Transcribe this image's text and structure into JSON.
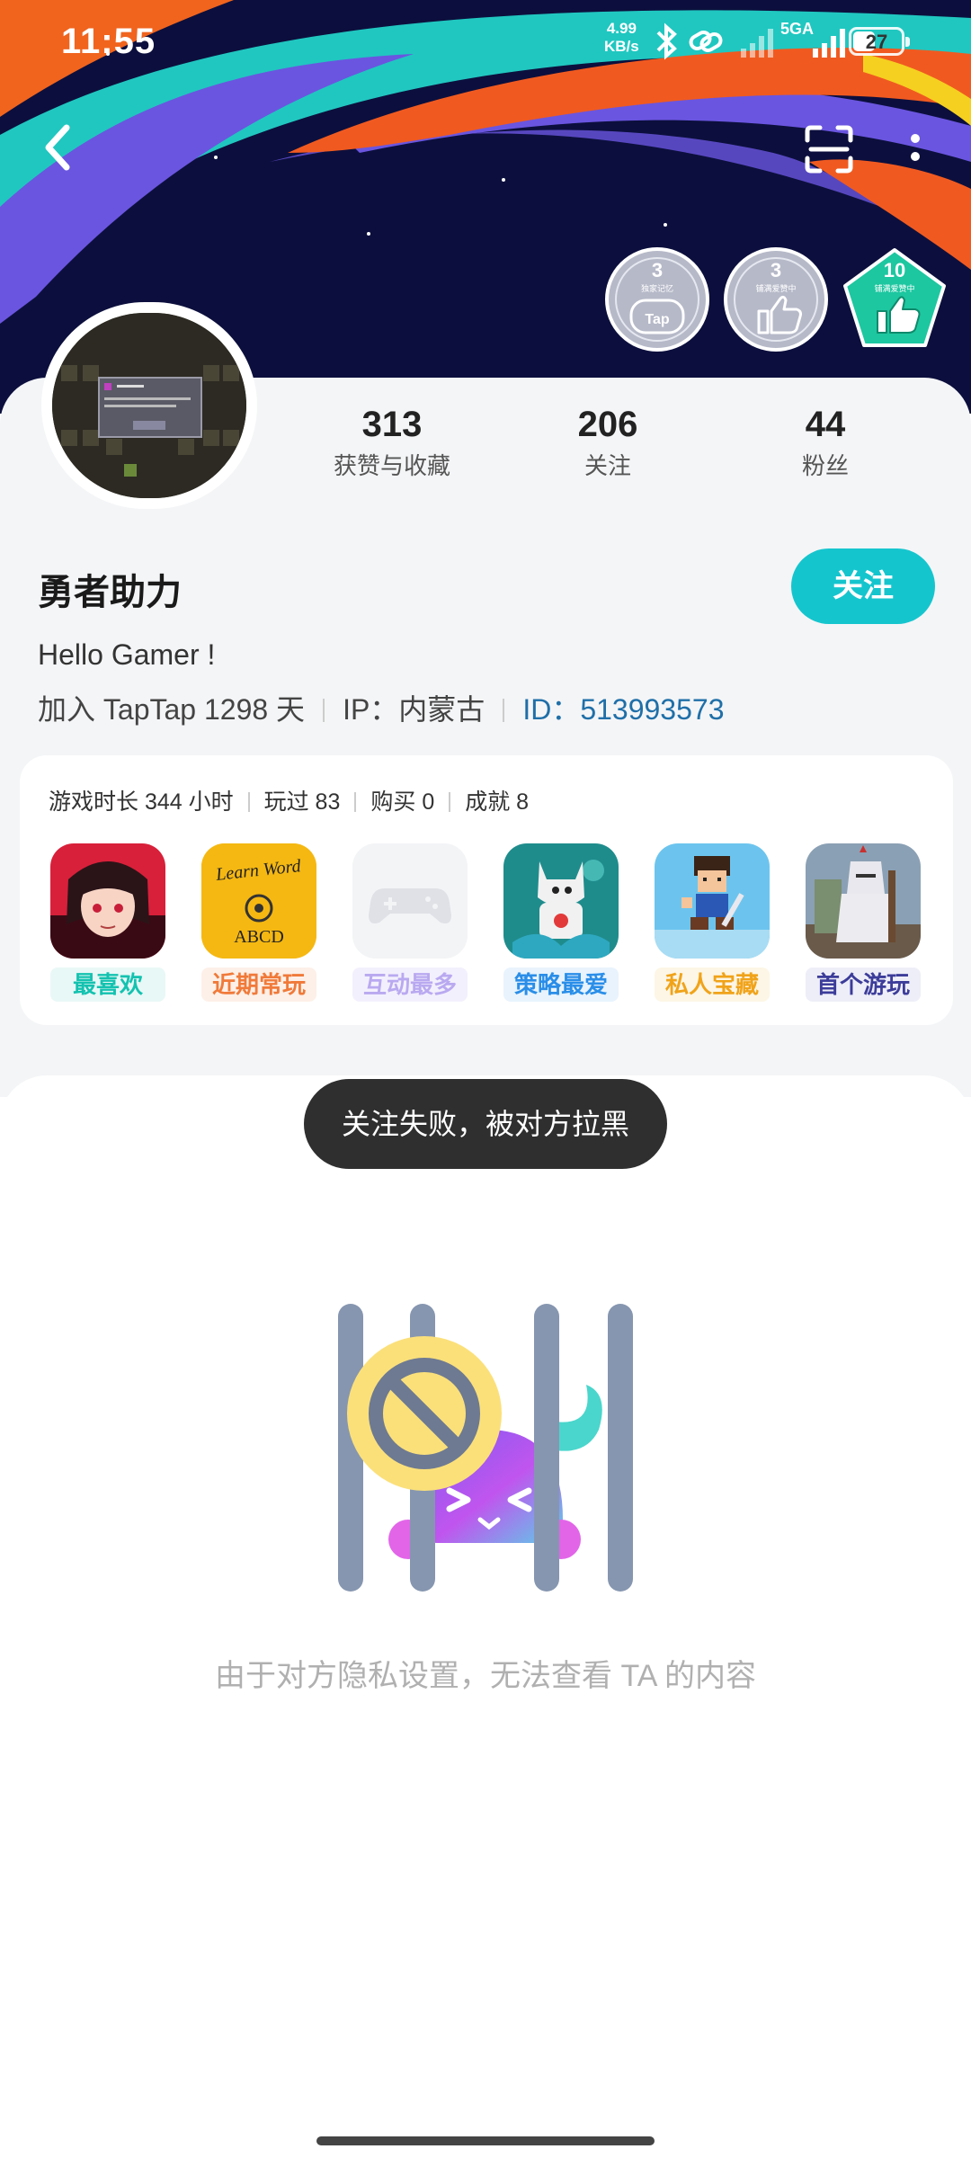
{
  "status_bar": {
    "time": "11:55",
    "net_speed_value": "4.99",
    "net_speed_unit": "KB/s",
    "network": "5GA",
    "battery": "27"
  },
  "header": {
    "badges": [
      {
        "count": "3",
        "title": "独家记忆",
        "glyph": "Tap",
        "color": "#b6b9c8"
      },
      {
        "count": "3",
        "title": "铺满爱赞中",
        "color": "#b6b9c8"
      },
      {
        "count": "10",
        "title": "铺满爱赞中",
        "color": "#1dc7a0"
      }
    ]
  },
  "profile": {
    "name": "勇者助力",
    "follow_label": "关注",
    "bio": "Hello Gamer !",
    "joined": "加入 TapTap 1298 天",
    "ip": "IP：内蒙古",
    "id": "ID：513993573",
    "stats": [
      {
        "value": "313",
        "label": "获赞与收藏"
      },
      {
        "value": "206",
        "label": "关注"
      },
      {
        "value": "44",
        "label": "粉丝"
      }
    ]
  },
  "games": {
    "stats": [
      "游戏时长 344 小时",
      "玩过 83",
      "购买 0",
      "成就 8"
    ],
    "items": [
      {
        "label": "最喜欢",
        "color": "#14c2b0",
        "bg": "#e8f8f6"
      },
      {
        "label": "近期常玩",
        "color": "#f07a3a",
        "bg": "#fdf0e8"
      },
      {
        "label": "互动最多",
        "color": "#b9a9f0",
        "bg": "#f3f0fd"
      },
      {
        "label": "策略最爱",
        "color": "#2a8ee8",
        "bg": "#e8f3fd"
      },
      {
        "label": "私人宝藏",
        "color": "#f0a31a",
        "bg": "#fdf6e6"
      },
      {
        "label": "首个游玩",
        "color": "#3c3c9a",
        "bg": "#eeeef8"
      }
    ],
    "icon2_text": "Learn Word",
    "icon2_letters": "ABCD"
  },
  "toast": "关注失败，被对方拉黑",
  "empty_text": "由于对方隐私设置，无法查看 TA 的内容"
}
